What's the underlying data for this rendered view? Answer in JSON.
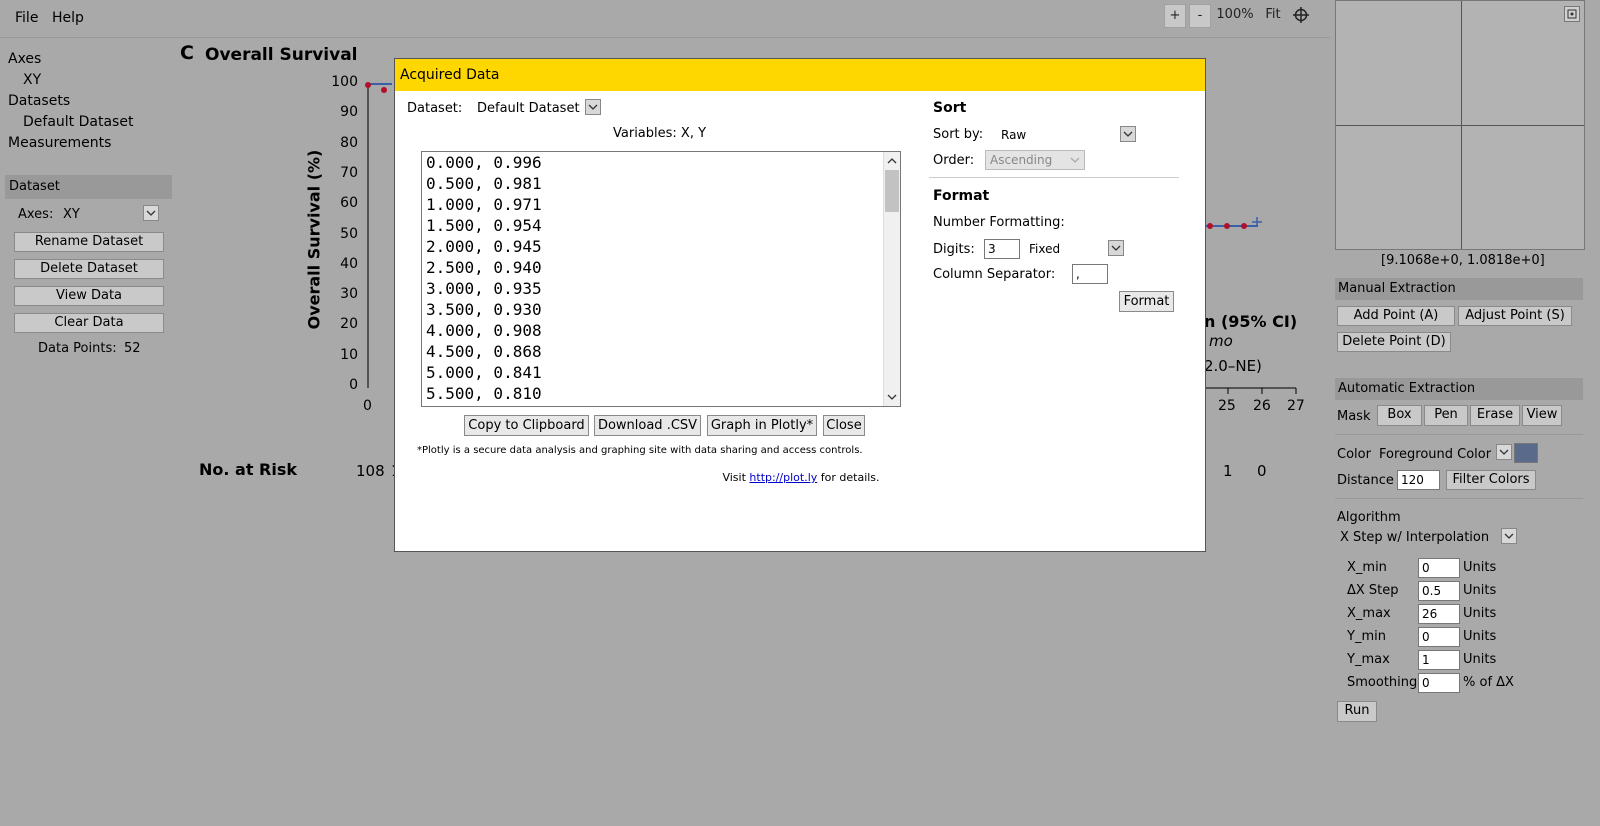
{
  "menubar": {
    "file": "File",
    "help": "Help"
  },
  "zoom": {
    "plus": "+",
    "minus": "-",
    "level": "100%",
    "fit": "Fit"
  },
  "tree": {
    "axes": "Axes",
    "xy": "XY",
    "datasets": "Datasets",
    "default_dataset": "Default Dataset",
    "measurements": "Measurements"
  },
  "dataset_panel": {
    "title": "Dataset",
    "axes_label": "Axes:",
    "axes_value": "XY",
    "rename": "Rename Dataset",
    "delete": "Delete Dataset",
    "view": "View Data",
    "clear": "Clear Data",
    "points_label": "Data Points:",
    "points_value": "52"
  },
  "plot": {
    "panel_letter": "C",
    "title": "Overall Survival",
    "ylabel": "Overall Survival (%)",
    "yticks": [
      "100",
      "90",
      "80",
      "70",
      "60",
      "50",
      "40",
      "30",
      "20",
      "10",
      "0"
    ],
    "xticks_left": [
      "0"
    ],
    "xticks_right": [
      "25",
      "26",
      "27"
    ],
    "at_risk_label": "No. at Risk",
    "at_risk_left": [
      "108",
      "1"
    ],
    "at_risk_right": [
      "1",
      "0"
    ],
    "legend_partial": "n (95% CI)",
    "legend_mo": "mo",
    "legend_ci": "2.0–NE)"
  },
  "dialog": {
    "title": "Acquired Data",
    "dataset_label": "Dataset:",
    "dataset_value": "Default Dataset",
    "variables": "Variables: X, Y",
    "rows": [
      "0.000, 0.996",
      "0.500, 0.981",
      "1.000, 0.971",
      "1.500, 0.954",
      "2.000, 0.945",
      "2.500, 0.940",
      "3.000, 0.935",
      "3.500, 0.930",
      "4.000, 0.908",
      "4.500, 0.868",
      "5.000, 0.841",
      "5.500, 0.810"
    ],
    "copy": "Copy to Clipboard",
    "download": "Download .CSV",
    "plotly": "Graph in Plotly*",
    "close": "Close",
    "note": "*Plotly is a secure data analysis and graphing site with data sharing and access controls.",
    "visit": "Visit",
    "link": "http://plot.ly",
    "details": "for details.",
    "sort_head": "Sort",
    "sort_by_label": "Sort by:",
    "sort_by_value": "Raw",
    "order_label": "Order:",
    "order_value": "Ascending",
    "format_head": "Format",
    "number_formatting": "Number Formatting:",
    "digits_label": "Digits:",
    "digits_value": "3",
    "digits_mode": "Fixed",
    "col_sep_label": "Column Separator:",
    "col_sep_value": ",",
    "format_btn": "Format"
  },
  "right": {
    "coords": "[9.1068e+0, 1.0818e+0]",
    "manual_head": "Manual Extraction",
    "add_point": "Add Point (A)",
    "adjust_point": "Adjust Point (S)",
    "delete_point": "Delete Point (D)",
    "auto_head": "Automatic Extraction",
    "mask": "Mask",
    "box": "Box",
    "pen": "Pen",
    "erase": "Erase",
    "view": "View",
    "color_label": "Color",
    "color_value": "Foreground Color",
    "swatch": "#5a6a8a",
    "distance_label": "Distance",
    "distance_value": "120",
    "filter_colors": "Filter Colors",
    "algorithm_label": "Algorithm",
    "algorithm_value": "X Step w/ Interpolation",
    "params": [
      {
        "label": "X_min",
        "value": "0",
        "unit": "Units"
      },
      {
        "label": "ΔX Step",
        "value": "0.5",
        "unit": "Units"
      },
      {
        "label": "X_max",
        "value": "26",
        "unit": "Units"
      },
      {
        "label": "Y_min",
        "value": "0",
        "unit": "Units"
      },
      {
        "label": "Y_max",
        "value": "1",
        "unit": "Units"
      },
      {
        "label": "Smoothing",
        "value": "0",
        "unit": "% of ΔX"
      }
    ],
    "run": "Run"
  }
}
